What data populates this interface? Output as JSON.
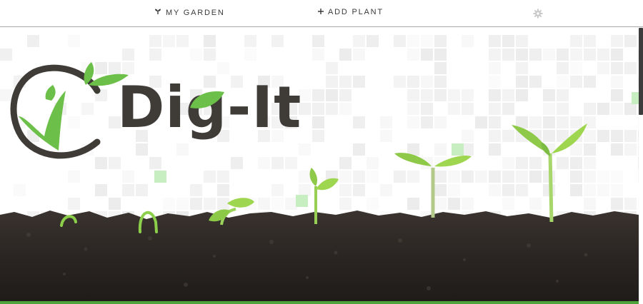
{
  "nav": {
    "my_garden_label": "MY GARDEN",
    "add_plant_label": "ADD PLANT",
    "add_plant_icon": "plus-icon",
    "my_garden_icon": "sprout-icon",
    "settings_icon": "gear-icon"
  },
  "hero": {
    "logo_text": "Dig-It",
    "colors": {
      "leaf_green": "#6cc04a",
      "logo_dark": "#3f3b37",
      "soil": "#2a2522",
      "tile_grey": "#ececec",
      "tile_green": "#c6eec0"
    }
  }
}
